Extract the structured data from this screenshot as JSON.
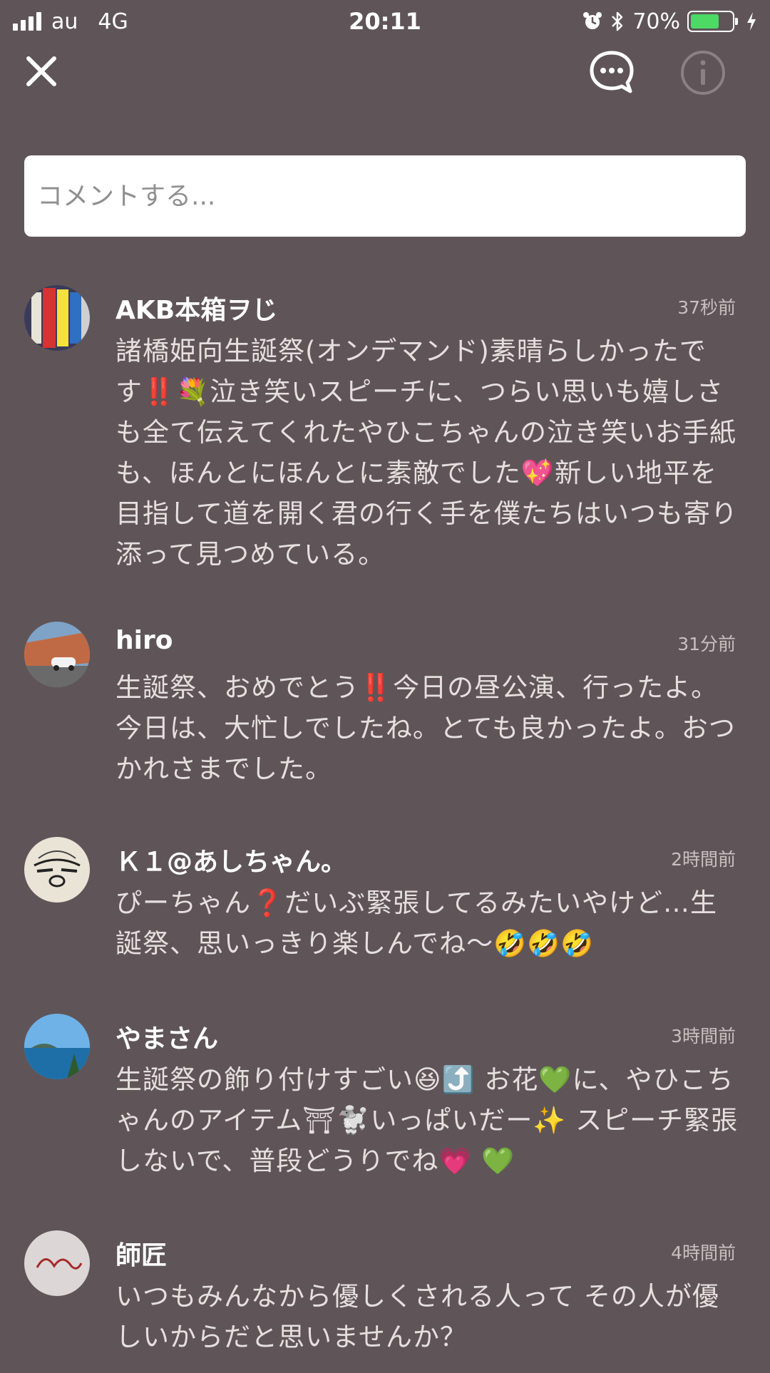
{
  "status_bar": {
    "carrier": "au",
    "network": "4G",
    "time": "20:11",
    "battery_text": "70%",
    "battery_level": 0.7,
    "battery_color": "#4cd964"
  },
  "header": {
    "close_icon": "close-icon",
    "chat_icon": "chat-bubble-icon",
    "info_icon": "info-icon"
  },
  "comment_input": {
    "placeholder": "コメントする..."
  },
  "comments": [
    {
      "name": "AKB本箱ヲじ",
      "time": "37秒前",
      "text": "諸橋姫向生誕祭(オンデマンド)素晴らしかったです‼️💐泣き笑いスピーチに、つらい思いも嬉しさも全て伝えてくれたやひこちゃんの泣き笑いお手紙も、ほんとにほんとに素敵でした💖新しい地平を目指して道を開く君の行く手を僕たちはいつも寄り添って見つめている。"
    },
    {
      "name": "hiro",
      "time": "31分前",
      "text": "生誕祭、おめでとう‼️今日の昼公演、行ったよ。今日は、大忙しでしたね。とても良かったよ。おつかれさまでした。"
    },
    {
      "name": "Ｋ１@あしちゃん。",
      "time": "2時間前",
      "text": "ぴーちゃん❓だいぶ緊張してるみたいやけど…生誕祭、思いっきり楽しんでね〜🤣🤣🤣"
    },
    {
      "name": "やまさん",
      "time": "3時間前",
      "text": "生誕祭の飾り付けすごい😆⤴️ お花💚に、やひこちゃんのアイテム⛩🐩いっぱいだー✨ スピーチ緊張しないで、普段どうりでね💗 💚"
    },
    {
      "name": "師匠",
      "time": "4時間前",
      "text": "いつもみんなから優しくされる人って その人が優しいからだと思いませんか？"
    }
  ]
}
